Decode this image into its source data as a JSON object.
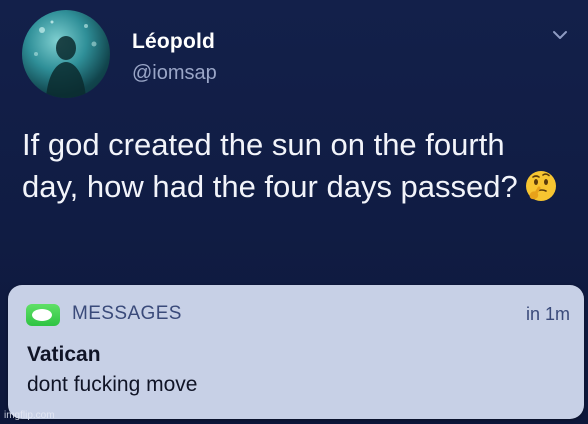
{
  "tweet": {
    "display_name": "Léopold",
    "handle": "@iomsap",
    "text": "If god created the sun on the fourth day, how had the four days passed?",
    "emoji": "thinking-face"
  },
  "notification": {
    "app_name": "MESSAGES",
    "timestamp": "in 1m",
    "sender": "Vatican",
    "body": "dont fucking move"
  },
  "watermark": "imgflip.com",
  "icons": {
    "avatar": "avatar-underwater",
    "chevron": "chevron-down-icon",
    "messages": "messages-app-icon",
    "emoji": "thinking-face-icon"
  },
  "colors": {
    "background": "#101c43",
    "notification_bg": "#c7d0e6",
    "messages_green": "#34c749",
    "text_primary": "#ffffff",
    "text_secondary": "#9aa6c7"
  }
}
